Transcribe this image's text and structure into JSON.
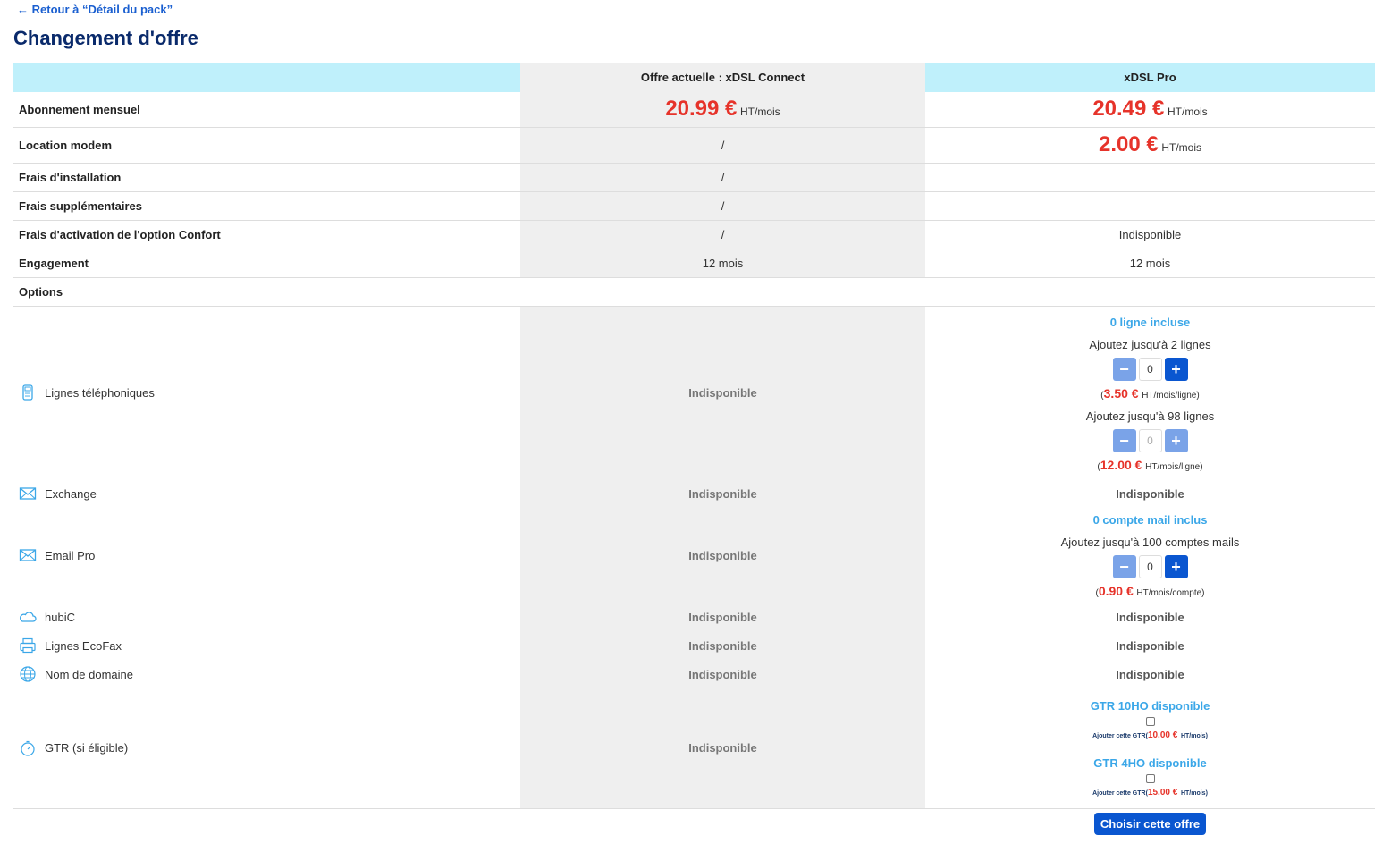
{
  "nav": {
    "back_arrow": "←",
    "back_label": "Retour à “Détail du pack”"
  },
  "page": {
    "title": "Changement d'offre"
  },
  "columns": {
    "current": "Offre actuelle : xDSL Connect",
    "new": "xDSL Pro"
  },
  "rows": {
    "monthly": {
      "label": "Abonnement mensuel",
      "current_price": "20.99 €",
      "current_unit": "HT/mois",
      "new_price": "20.49 €",
      "new_unit": "HT/mois"
    },
    "modem": {
      "label": "Location modem",
      "current": "/",
      "new_price": "2.00 €",
      "new_unit": "HT/mois"
    },
    "install": {
      "label": "Frais d'installation",
      "current": "/",
      "new": ""
    },
    "extra": {
      "label": "Frais supplémentaires",
      "current": "/",
      "new": ""
    },
    "confort": {
      "label": "Frais d'activation de l'option Confort",
      "current": "/",
      "new": "Indisponible"
    },
    "engagement": {
      "label": "Engagement",
      "current": "12 mois",
      "new": "12 mois"
    },
    "options": {
      "label": "Options"
    }
  },
  "options": {
    "phone": {
      "label": "Lignes téléphoniques",
      "icon": "phone-icon",
      "current": "Indisponible",
      "included": "0 ligne incluse",
      "add1": "Ajoutez jusqu'à 2 lignes",
      "qty1": "0",
      "price1": "3.50 €",
      "unit1": "HT/mois/ligne",
      "add2": "Ajoutez jusqu'à 98 lignes",
      "qty2": "0",
      "price2": "12.00 €",
      "unit2": "HT/mois/ligne",
      "minus": "−",
      "plus": "+",
      "open": "(",
      "close": ")"
    },
    "exchange": {
      "label": "Exchange",
      "icon": "mail-icon",
      "current": "Indisponible",
      "new": "Indisponible"
    },
    "emailpro": {
      "label": "Email Pro",
      "icon": "mail-icon",
      "current": "Indisponible",
      "included": "0 compte mail inclus",
      "add": "Ajoutez jusqu'à 100 comptes mails",
      "qty": "0",
      "price": "0.90 €",
      "unit": "HT/mois/compte"
    },
    "hubic": {
      "label": "hubiC",
      "icon": "cloud-icon",
      "current": "Indisponible",
      "new": "Indisponible"
    },
    "ecofax": {
      "label": "Lignes EcoFax",
      "icon": "fax-icon",
      "current": "Indisponible",
      "new": "Indisponible"
    },
    "domain": {
      "label": "Nom de domaine",
      "icon": "globe-icon",
      "current": "Indisponible",
      "new": "Indisponible"
    },
    "gtr": {
      "label": "GTR (si éligible)",
      "icon": "clock-icon",
      "current": "Indisponible",
      "gtr10": "GTR 10HO disponible",
      "gtr10_add": "Ajouter cette GTR",
      "gtr10_price": "10.00 €",
      "gtr10_unit": "HT/mois",
      "gtr4": "GTR 4HO disponible",
      "gtr4_add": "Ajouter cette GTR",
      "gtr4_price": "15.00 €",
      "gtr4_unit": "HT/mois"
    }
  },
  "actions": {
    "choose": "Choisir cette offre"
  },
  "colors": {
    "accent": "#0a56d0",
    "price": "#e6332a",
    "header_bg": "#bff0fb",
    "current_bg": "#efefef",
    "included": "#3ba7e8"
  }
}
